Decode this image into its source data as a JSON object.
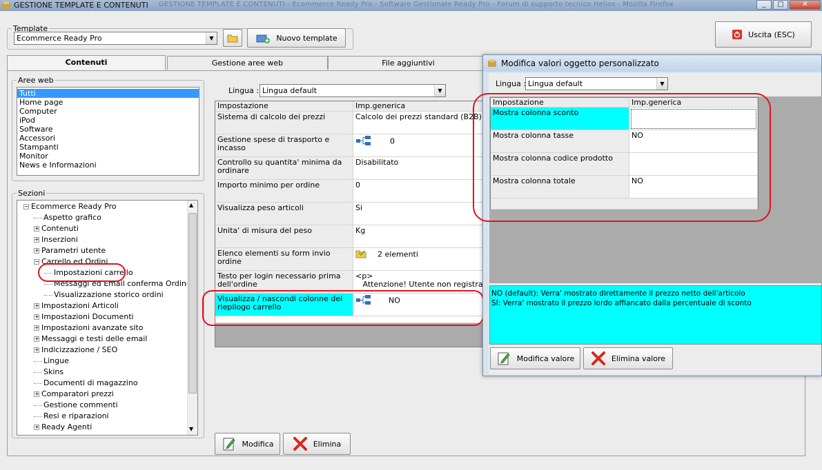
{
  "window": {
    "title": "GESTIONE TEMPLATE E CONTENUTI",
    "ghost_title": "GESTIONE TEMPLATE E CONTENUTI - Ecommerce Ready Pro - Software Gestionale Ready Pro - Forum di supporto tecnico Helios - Mozilla Firefox"
  },
  "template": {
    "legend": "Template",
    "selected": "Ecommerce Ready Pro",
    "new_label": "Nuovo template"
  },
  "exit_label": "Uscita (ESC)",
  "tabs": [
    "Contenuti",
    "Gestione aree web",
    "File aggiuntivi"
  ],
  "aree_web": {
    "legend": "Aree web",
    "items": [
      "Tutti",
      "Home page",
      "Computer",
      "iPod",
      "Software",
      "Accessori",
      "Stampanti",
      "Monitor",
      "News e Informazioni"
    ]
  },
  "sezioni": {
    "legend": "Sezioni",
    "items": [
      {
        "label": "Ecommerce Ready Pro",
        "level": 0,
        "exp": "-"
      },
      {
        "label": "Aspetto grafico",
        "level": 1,
        "exp": ""
      },
      {
        "label": "Contenuti",
        "level": 1,
        "exp": "+"
      },
      {
        "label": "Inserzioni",
        "level": 1,
        "exp": "+"
      },
      {
        "label": "Parametri utente",
        "level": 1,
        "exp": "+"
      },
      {
        "label": "Carrello ed Ordini",
        "level": 1,
        "exp": "-"
      },
      {
        "label": "Impostazioni carrello",
        "level": 2,
        "exp": ""
      },
      {
        "label": "Messaggi ed Email conferma Ordine",
        "level": 2,
        "exp": ""
      },
      {
        "label": "Visualizzazione storico ordini",
        "level": 2,
        "exp": ""
      },
      {
        "label": "Impostazioni Articoli",
        "level": 1,
        "exp": "+"
      },
      {
        "label": "Impostazioni Documenti",
        "level": 1,
        "exp": "+"
      },
      {
        "label": "Impostazioni avanzate sito",
        "level": 1,
        "exp": "+"
      },
      {
        "label": "Messaggi e testi delle email",
        "level": 1,
        "exp": "+"
      },
      {
        "label": "Indicizzazione / SEO",
        "level": 1,
        "exp": "+"
      },
      {
        "label": "Lingue",
        "level": 1,
        "exp": ""
      },
      {
        "label": "Skins",
        "level": 1,
        "exp": ""
      },
      {
        "label": "Documenti di magazzino",
        "level": 1,
        "exp": ""
      },
      {
        "label": "Comparatori prezzi",
        "level": 1,
        "exp": "+"
      },
      {
        "label": "Gestione commenti",
        "level": 1,
        "exp": ""
      },
      {
        "label": "Resi e riparazioni",
        "level": 1,
        "exp": ""
      },
      {
        "label": "Ready Agenti",
        "level": 1,
        "exp": "+"
      }
    ]
  },
  "main": {
    "lingua_label": "Lingua :",
    "lingua_value": "Lingua default",
    "col1": "Impostazione",
    "col2": "Imp.generica",
    "rows": [
      {
        "k": "Sistema di calcolo dei prezzi",
        "v": "Calcolo dei prezzi standard (B2B)",
        "icon": ""
      },
      {
        "k": "Gestione spese di trasporto e incasso",
        "v": "0",
        "icon": "tree"
      },
      {
        "k": "Controllo su quantita' minima da ordinare",
        "v": "Disabilitato",
        "icon": ""
      },
      {
        "k": "Importo minimo per ordine",
        "v": "0",
        "icon": ""
      },
      {
        "k": "Visualizza peso articoli",
        "v": "Si",
        "icon": ""
      },
      {
        "k": "Unita' di misura del peso",
        "v": "Kg",
        "icon": ""
      },
      {
        "k": "Elenco elementi su form invio ordine",
        "v": "2 elementi",
        "icon": "folder"
      },
      {
        "k": "Testo per login necessario prima dell'ordine",
        "v": "<p>\n   Attenzione! Utente non registrato.",
        "icon": ""
      },
      {
        "k": "Visualizza / nascondi colonne del riepilogo carrello",
        "v": "NO",
        "icon": "tree"
      }
    ],
    "modifica": "Modifica",
    "elimina": "Elimina"
  },
  "dialog": {
    "title": "Modifica valori oggetto personalizzato",
    "lingua_label": "Lingua :",
    "lingua_value": "Lingua default",
    "col1": "Impostazione",
    "col2": "Imp.generica",
    "rows": [
      {
        "k": "Mostra colonna sconto",
        "v": ""
      },
      {
        "k": "Mostra colonna tasse",
        "v": "NO"
      },
      {
        "k": "Mostra colonna codice prodotto",
        "v": ""
      },
      {
        "k": "Mostra colonna totale",
        "v": "NO"
      }
    ],
    "info_line1": "NO (default): Verra' mostrato direttamente il prezzo netto dell'articolo",
    "info_line2": "SI: Verra' mostrato il prezzo lordo affiancato dalla percentuale di sconto",
    "modifica": "Modifica valore",
    "elimina": "Elimina valore"
  },
  "colors": {
    "highlight": "#00ffff",
    "selection": "#3399ff",
    "annotation": "#e0121b"
  }
}
